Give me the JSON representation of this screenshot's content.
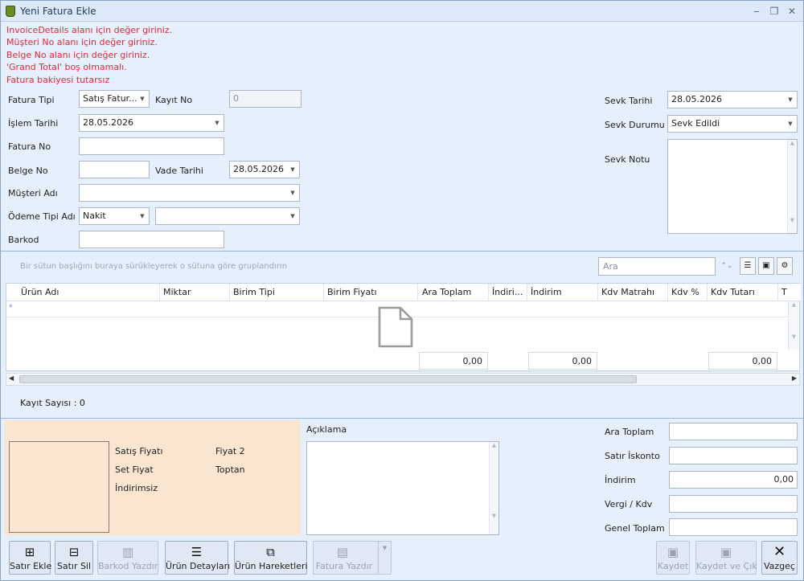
{
  "window": {
    "title": "Yeni Fatura Ekle",
    "min": "‒",
    "max": "❐",
    "close": "✕"
  },
  "errors": [
    "InvoiceDetails alanı için değer giriniz.",
    "Müşteri No alanı için değer giriniz.",
    "Belge No alanı için değer giriniz.",
    "'Grand Total' boş olmamalı.",
    "Fatura bakiyesi tutarsız"
  ],
  "form": {
    "fatura_tipi_label": "Fatura Tipi",
    "fatura_tipi_value": "Satış Fatur...",
    "kayit_no_label": "Kayıt No",
    "kayit_no_value": "0",
    "islem_tarihi_label": "İşlem Tarihi",
    "islem_tarihi_value": "28.05.2026",
    "fatura_no_label": "Fatura No",
    "fatura_no_value": "",
    "belge_no_label": "Belge No",
    "belge_no_value": "",
    "vade_tarihi_label": "Vade Tarihi",
    "vade_tarihi_value": "28.05.2026",
    "musteri_adi_label": "Müşteri Adı",
    "musteri_adi_value": "",
    "odeme_tipi_label": "Ödeme Tipi Adı",
    "odeme_tipi_value": "Nakit",
    "odeme_tipi_2_value": "",
    "barkod_label": "Barkod",
    "barkod_value": "",
    "sevk_tarihi_label": "Sevk Tarihi",
    "sevk_tarihi_value": "28.05.2026",
    "sevk_durumu_label": "Sevk Durumu",
    "sevk_durumu_value": "Sevk Edildi",
    "sevk_notu_label": "Sevk Notu",
    "sevk_notu_value": ""
  },
  "grid": {
    "group_hint": "Bir sütun başlığını buraya sürükleyerek o sütuna göre gruplandırın",
    "search_placeholder": "Ara",
    "columns": [
      "Ürün Adı",
      "Miktar",
      "Birim Tipi",
      "Birim Fiyatı",
      "Ara Toplam",
      "İndiri...",
      "İndirim",
      "Kdv Matrahı",
      "Kdv %",
      "Kdv Tutarı",
      "T"
    ],
    "newrow_marker": "*",
    "footer": {
      "ara_toplam": "0,00",
      "indirim": "0,00",
      "kdv_tutari": "0,00"
    },
    "record_count": "Kayıt Sayısı : 0"
  },
  "price_box": {
    "satis_fiyati": "Satış Fiyatı",
    "fiyat2": "Fiyat 2",
    "set_fiyat": "Set Fiyat",
    "toptan": "Toptan",
    "indirimsiz": "İndirimsiz"
  },
  "aciklama_label": "Açıklama",
  "totals": {
    "ara_toplam_label": "Ara Toplam",
    "ara_toplam_value": "",
    "satir_iskonto_label": "Satır İskonto",
    "satir_iskonto_value": "",
    "indirim_label": "İndirim",
    "indirim_value": "0,00",
    "vergi_label": "Vergi / Kdv",
    "vergi_value": "",
    "genel_toplam_label": "Genel Toplam",
    "genel_toplam_value": ""
  },
  "buttons": {
    "satir_ekle": "Satır Ekle",
    "satir_sil": "Satır Sil",
    "barkod_yazdir": "Barkod Yazdır",
    "urun_detaylari": "Ürün Detayları",
    "urun_hareketleri": "Ürün Hareketleri",
    "fatura_yazdir": "Fatura Yazdır",
    "kaydet": "Kaydet",
    "kaydet_ve_cik": "Kaydet ve Çık",
    "vazgec": "Vazgeç"
  },
  "colors": {
    "error": "#e0283a",
    "form_bg": "#e6effc",
    "price_box_bg": "#fae5d1"
  }
}
